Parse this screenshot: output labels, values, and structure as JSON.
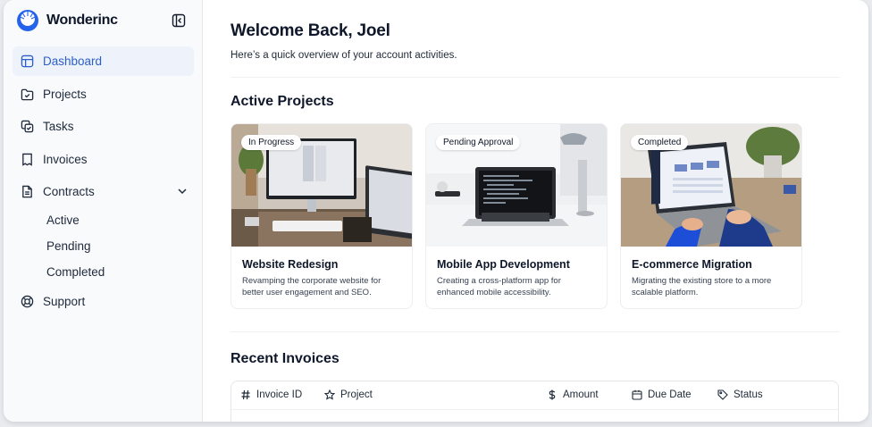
{
  "brand": {
    "name": "Wonderinc"
  },
  "sidebar": {
    "items": [
      {
        "label": "Dashboard",
        "icon": "layout-icon"
      },
      {
        "label": "Projects",
        "icon": "folder-check-icon"
      },
      {
        "label": "Tasks",
        "icon": "tasks-icon"
      },
      {
        "label": "Invoices",
        "icon": "receipt-icon"
      },
      {
        "label": "Contracts",
        "icon": "file-icon"
      },
      {
        "label": "Support",
        "icon": "lifebuoy-icon"
      }
    ],
    "contracts_sub": [
      "Active",
      "Pending",
      "Completed"
    ]
  },
  "header": {
    "title": "Welcome Back, Joel",
    "subtitle": "Here’s a quick overview of your account activities."
  },
  "projects": {
    "heading": "Active Projects",
    "cards": [
      {
        "status": "In Progress",
        "title": "Website Redesign",
        "description": "Revamping the corporate website for better user engagement and SEO."
      },
      {
        "status": "Pending Approval",
        "title": "Mobile App Development",
        "description": "Creating a cross-platform app for enhanced mobile accessibility."
      },
      {
        "status": "Completed",
        "title": "E-commerce Migration",
        "description": "Migrating the existing store to a more scalable platform."
      }
    ]
  },
  "invoices": {
    "heading": "Recent Invoices",
    "columns": [
      "Invoice ID",
      "Project",
      "Amount",
      "Due Date",
      "Status"
    ]
  },
  "colors": {
    "accent": "#2b5fcb",
    "active_bg": "#eef2fa",
    "sidebar_bg": "#f8fafc"
  }
}
